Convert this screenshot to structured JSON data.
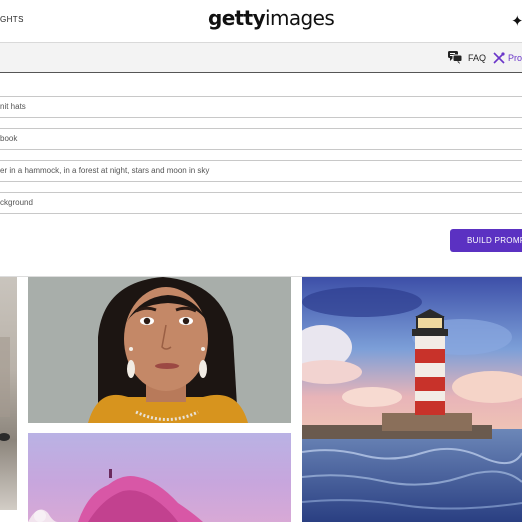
{
  "header": {
    "nav_left": "GHTS",
    "logo_bold": "getty",
    "logo_regular": "images"
  },
  "subbar": {
    "faq_label": "FAQ",
    "prompt_label": "Pro"
  },
  "form": {
    "fields": [
      "nit hats",
      "book",
      "er in a hammock, in a forest at night, stars and moon in sky",
      "ckground"
    ],
    "build_button": "BUILD PROMP"
  },
  "colors": {
    "accent": "#5b31c2",
    "prompt_text": "#6a35c9"
  },
  "icons": [
    "sparkle-icon",
    "chat-bubbles-icon",
    "tools-icon"
  ]
}
